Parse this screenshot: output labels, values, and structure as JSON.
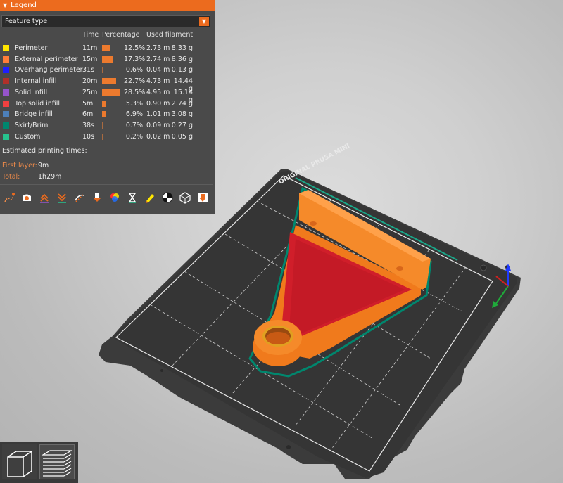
{
  "legend": {
    "title": "Legend",
    "view_mode": "Feature type",
    "headers": {
      "time": "Time",
      "percentage": "Percentage",
      "used_filament": "Used filament"
    },
    "rows": [
      {
        "name": "Perimeter",
        "color": "#ffe600",
        "time": "11m",
        "percent": "12.5%",
        "fraction": 0.125,
        "length": "2.73 m",
        "weight": "8.33 g"
      },
      {
        "name": "External perimeter",
        "color": "#ff7d38",
        "time": "15m",
        "percent": "17.3%",
        "fraction": 0.173,
        "length": "2.74 m",
        "weight": "8.36 g"
      },
      {
        "name": "Overhang perimeter",
        "color": "#1f1fff",
        "time": "31s",
        "percent": "0.6%",
        "fraction": 0.006,
        "length": "0.04 m",
        "weight": "0.13 g"
      },
      {
        "name": "Internal infill",
        "color": "#b03029",
        "time": "20m",
        "percent": "22.7%",
        "fraction": 0.227,
        "length": "4.73 m",
        "weight": "14.44 g"
      },
      {
        "name": "Solid infill",
        "color": "#9654cc",
        "time": "25m",
        "percent": "28.5%",
        "fraction": 0.285,
        "length": "4.95 m",
        "weight": "15.14 g"
      },
      {
        "name": "Top solid infill",
        "color": "#f04040",
        "time": "5m",
        "percent": "5.3%",
        "fraction": 0.053,
        "length": "0.90 m",
        "weight": "2.74 g"
      },
      {
        "name": "Bridge infill",
        "color": "#4d80ba",
        "time": "6m",
        "percent": "6.9%",
        "fraction": 0.069,
        "length": "1.01 m",
        "weight": "3.08 g"
      },
      {
        "name": "Skirt/Brim",
        "color": "#00876e",
        "time": "38s",
        "percent": "0.7%",
        "fraction": 0.007,
        "length": "0.09 m",
        "weight": "0.27 g"
      },
      {
        "name": "Custom",
        "color": "#27c28e",
        "time": "10s",
        "percent": "0.2%",
        "fraction": 0.002,
        "length": "0.02 m",
        "weight": "0.05 g"
      }
    ],
    "estimated_label": "Estimated printing times:",
    "first_layer_label": "First layer:",
    "first_layer_value": "9m",
    "total_label": "Total:",
    "total_value": "1h29m"
  },
  "bed": {
    "brand_text": "ORIGINAL PRUSA MINI"
  },
  "colors": {
    "accent": "#ec6b1e",
    "panel": "#4a4a4a"
  }
}
